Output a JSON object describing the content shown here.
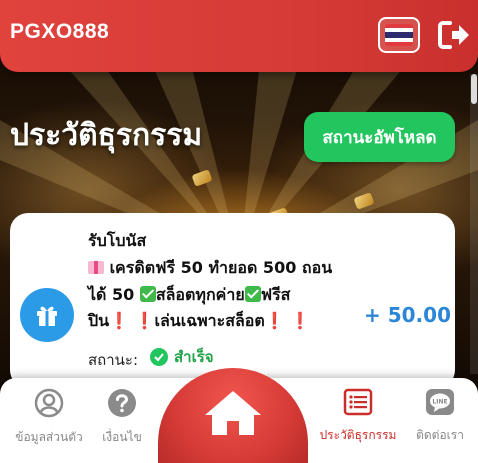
{
  "app": {
    "brand": "PGXO888"
  },
  "header": {
    "flag_icon": "thailand-flag-icon",
    "logout_icon": "logout-icon"
  },
  "page": {
    "title": "ประวัติธุรกรรม",
    "upload_status_label": "สถานะอัพโหลด"
  },
  "transaction": {
    "title": "รับโบนัส",
    "line1": "เครดิตฟรี 50 ทำยอด 500 ถอน",
    "line2_a": "ได้ 50",
    "line2_b": "สล็อตทุกค่าย",
    "line2_c": "ฟรีส",
    "line3_a": "ปิน",
    "line3_b": "เล่นเฉพาะสล็อต",
    "amount": "+ 50.00",
    "status_label": "สถานะ:",
    "status_value": "สำเร็จ",
    "icon": "gift-icon"
  },
  "nav": {
    "items": [
      {
        "label": "ข้อมูลส่วนตัว",
        "icon": "user-icon"
      },
      {
        "label": "เงื่อนไข",
        "icon": "question-icon"
      },
      {
        "label": "",
        "icon": "home-icon"
      },
      {
        "label": "ประวัติธุรกรรม",
        "icon": "list-icon"
      },
      {
        "label": "ติดต่อเรา",
        "icon": "line-icon"
      }
    ]
  },
  "colors": {
    "primary": "#d63b37",
    "success": "#22c55e",
    "info": "#2b9be8"
  }
}
